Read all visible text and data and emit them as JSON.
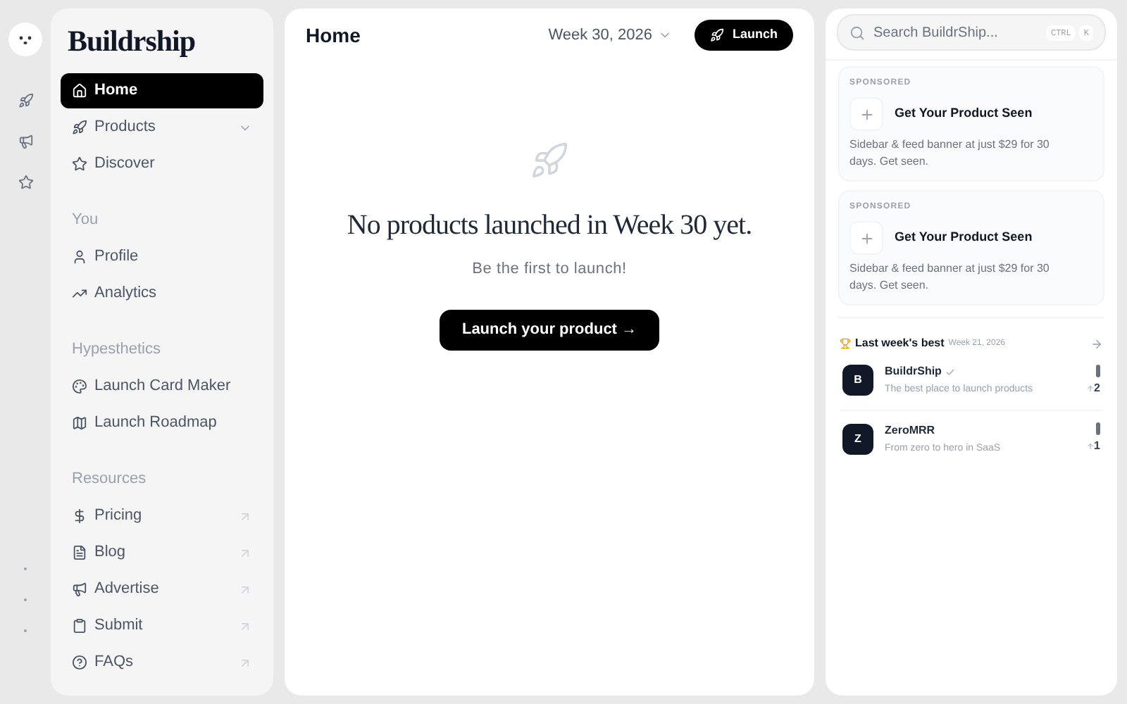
{
  "brand": "Buildrship",
  "nav": [
    {
      "kind": "item",
      "label": "Home",
      "selected": true
    },
    {
      "kind": "expandable",
      "label": "Products",
      "selected": false
    },
    {
      "kind": "item",
      "label": "Discover",
      "selected": false
    },
    {
      "kind": "heading",
      "label": "You"
    },
    {
      "kind": "item",
      "label": "Profile",
      "selected": false
    },
    {
      "kind": "item",
      "label": "Analytics",
      "selected": false
    },
    {
      "kind": "heading",
      "label": "Hypesthetics"
    },
    {
      "kind": "item",
      "label": "Launch Card Maker",
      "selected": false
    },
    {
      "kind": "item",
      "label": "Launch Roadmap",
      "selected": false
    },
    {
      "kind": "heading",
      "label": "Resources"
    },
    {
      "kind": "external",
      "label": "Pricing",
      "selected": false
    },
    {
      "kind": "external",
      "label": "Blog",
      "selected": false
    },
    {
      "kind": "external",
      "label": "Advertise",
      "selected": false
    },
    {
      "kind": "external",
      "label": "Submit",
      "selected": false
    },
    {
      "kind": "external",
      "label": "FAQs",
      "selected": false
    }
  ],
  "main": {
    "title": "Home",
    "week_picker": "Week 30, 2026",
    "launch_button": "Launch",
    "empty_title": "No products launched in Week 30 yet.",
    "empty_subtitle": "Be the first to launch!",
    "cta": "Launch your product →"
  },
  "search": {
    "placeholder": "Search BuildrShip...",
    "shortcut": [
      "CTRL",
      "K"
    ]
  },
  "sponsored": [
    {
      "tag": "SPONSORED",
      "title": "Get Your Product Seen",
      "text": "Sidebar & feed banner at just $29 for 30 days. Get seen."
    },
    {
      "tag": "SPONSORED",
      "title": "Get Your Product Seen",
      "text": "Sidebar & feed banner at just $29 for 30 days. Get seen."
    }
  ],
  "last_week": {
    "title": "Last week's best",
    "week": "Week 21, 2026",
    "products": [
      {
        "initial": "B",
        "name": "BuildrShip",
        "verified": true,
        "tagline": "The best place to launch products",
        "votes": "2"
      },
      {
        "initial": "Z",
        "name": "ZeroMRR",
        "verified": false,
        "tagline": "From zero to hero in SaaS",
        "votes": "1"
      }
    ]
  }
}
